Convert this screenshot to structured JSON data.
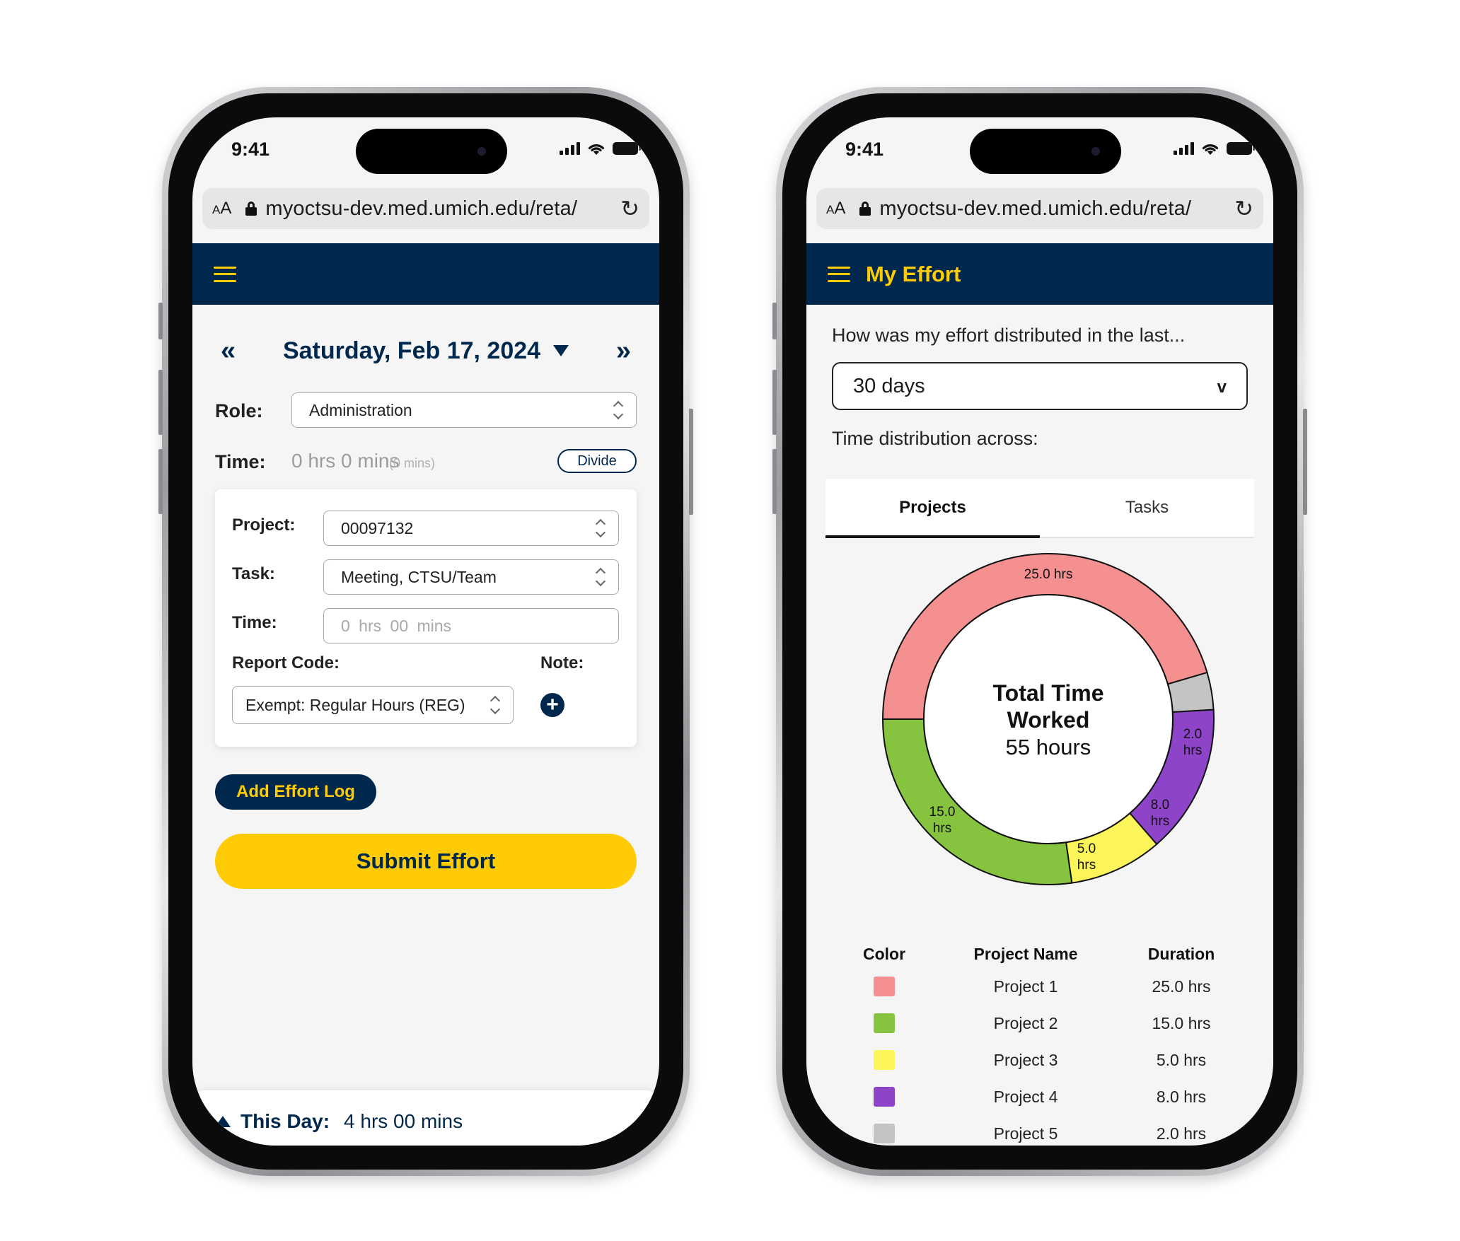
{
  "status": {
    "time": "9:41"
  },
  "browser": {
    "text_size_small": "A",
    "text_size_large": "A",
    "url": "myoctsu-dev.med.umich.edu/reta/",
    "reload_glyph": "↻"
  },
  "left": {
    "header_title": "",
    "date_nav": {
      "prev": "«",
      "title": "Saturday, Feb 17, 2024",
      "next": "»"
    },
    "role": {
      "label": "Role:",
      "value": "Administration"
    },
    "time": {
      "label": "Time:",
      "value": "0 hrs 0 mins",
      "mins": "(0 mins)",
      "divide_label": "Divide"
    },
    "entry": {
      "project_label": "Project:",
      "project_value": "00097132",
      "task_label": "Task:",
      "task_value": "Meeting, CTSU/Team",
      "time_label": "Time:",
      "time_placeholder": "0 hrs 00 mins",
      "report_code_label": "Report Code:",
      "report_code_value": "Exempt: Regular Hours (REG)",
      "note_label": "Note:",
      "note_add": "+"
    },
    "add_effort_label": "Add Effort Log",
    "submit_label": "Submit Effort",
    "bottom": {
      "label": "This Day:",
      "value": "4 hrs 00 mins"
    }
  },
  "right": {
    "header_title": "My Effort",
    "question": "How was my effort distributed in the last...",
    "period": {
      "value": "30 days",
      "chevron": "v"
    },
    "distribution_label": "Time distribution across:",
    "tabs": [
      "Projects",
      "Tasks"
    ],
    "donut_center": {
      "title_line1": "Total Time",
      "title_line2": "Worked",
      "total": "55 hours"
    },
    "legend_headers": {
      "color": "Color",
      "name": "Project Name",
      "duration": "Duration"
    },
    "segment_labels": [
      {
        "amount": "25.0 hrs",
        "unit": ""
      },
      {
        "amount": "2.0",
        "unit": "hrs"
      },
      {
        "amount": "8.0",
        "unit": "hrs"
      },
      {
        "amount": "5.0",
        "unit": "hrs"
      },
      {
        "amount": "15.0",
        "unit": "hrs"
      }
    ]
  },
  "chart_data": {
    "type": "pie",
    "title": "Total Time Worked",
    "total_label": "55 hours",
    "series": [
      {
        "name": "Project 1",
        "value": 25.0,
        "label": "25.0 hrs",
        "color": "#f4908f"
      },
      {
        "name": "Project 5",
        "value": 2.0,
        "label": "2.0 hrs",
        "color": "#c4c4c4"
      },
      {
        "name": "Project 4",
        "value": 8.0,
        "label": "8.0 hrs",
        "color": "#8d44c8"
      },
      {
        "name": "Project 3",
        "value": 5.0,
        "label": "5.0 hrs",
        "color": "#fcf55a"
      },
      {
        "name": "Project 2",
        "value": 15.0,
        "label": "15.0 hrs",
        "color": "#86c440"
      }
    ],
    "legend": [
      {
        "name": "Project 1",
        "duration": "25.0 hrs",
        "color": "#f4908f"
      },
      {
        "name": "Project 2",
        "duration": "15.0 hrs",
        "color": "#86c440"
      },
      {
        "name": "Project 3",
        "duration": "5.0 hrs",
        "color": "#fcf55a"
      },
      {
        "name": "Project 4",
        "duration": "8.0 hrs",
        "color": "#8d44c8"
      },
      {
        "name": "Project 5",
        "duration": "2.0 hrs",
        "color": "#c4c4c4"
      }
    ]
  },
  "colors": {
    "navy": "#00274c",
    "maize": "#ffcb05"
  }
}
